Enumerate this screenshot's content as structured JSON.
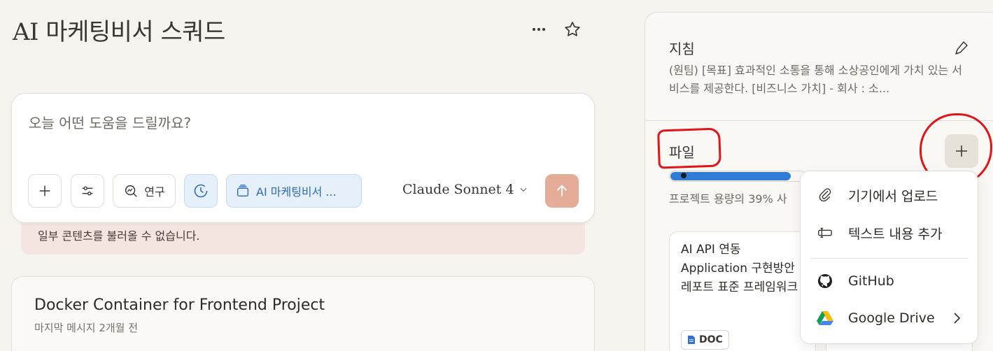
{
  "header": {
    "title": "AI 마케팅비서 스쿼드"
  },
  "composer": {
    "placeholder": "오늘 어떤 도움을 드릴까요?",
    "research_label": "연구",
    "project_label": "AI 마케팅비서 ...",
    "model_label": "Claude Sonnet 4",
    "error_text": "일부 콘텐츠를 불러올 수 없습니다."
  },
  "conversation": {
    "title": "Docker Container for Frontend Project",
    "meta": "마지막 메시지 2개월 전"
  },
  "instructions": {
    "heading": "지침",
    "body": "(원팀) [목표] 효과적인 소통을 통해 소상공인에게 가치 있는 서비스를 제공한다. [비즈니스 가치] - 회사 : 소..."
  },
  "files": {
    "heading": "파일",
    "capacity_text": "프로젝트 용량의 39% 사",
    "capacity_fraction": 0.39,
    "cards": [
      {
        "title": "AI API 연동 Application 구현방안 레포트 표준 프레임워크",
        "badge": "DOC"
      }
    ]
  },
  "menu": {
    "items": [
      {
        "label": "기기에서 업로드",
        "icon": "paperclip-icon"
      },
      {
        "label": "텍스트 내용 추가",
        "icon": "text-add-icon"
      },
      {
        "label": "GitHub",
        "icon": "github-icon"
      },
      {
        "label": "Google Drive",
        "icon": "google-drive-icon"
      }
    ]
  },
  "colors": {
    "accent_send": "#e5ad98",
    "capacity_fill": "#2f7bd6",
    "annotation_red": "#e0141a",
    "project_chip": "#e6f0fb"
  }
}
